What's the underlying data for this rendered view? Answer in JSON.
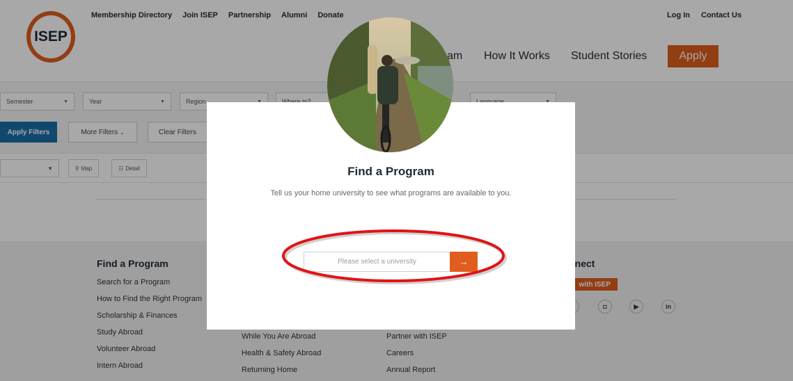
{
  "brand": {
    "logo_text": "ISEP",
    "accent": "#e05d1e",
    "blue": "#1a6ea8"
  },
  "header": {
    "top_links": [
      "Membership Directory",
      "Join ISEP",
      "Partnership",
      "Alumni",
      "Donate"
    ],
    "login": "Log In",
    "contact": "Contact Us",
    "main_nav_partial": "am",
    "main_nav": [
      "How It Works",
      "Student Stories"
    ],
    "apply": "Apply"
  },
  "filters": {
    "semester": "Semester",
    "year": "Year",
    "region": "Region",
    "where": "Where to?",
    "language": "Language",
    "apply_filters": "Apply Filters",
    "more_filters": "More Filters",
    "more_filters_chevron": "chevron-down-icon",
    "clear_filters": "Clear Filters"
  },
  "view": {
    "map": "Map",
    "detail": "Detail"
  },
  "footer": {
    "col1_title": "Find a Program",
    "col1": [
      "Search for a Program",
      "How to Find the Right Program",
      "Scholarship & Finances",
      "Study Abroad",
      "Volunteer Abroad",
      "Intern Abroad"
    ],
    "col2": [
      "While You Are Abroad",
      "Health & Safety Abroad",
      "Returning Home"
    ],
    "col3": [
      "Partner with ISEP",
      "Careers",
      "Annual Report"
    ],
    "col4_title": "nnect",
    "col4_tag": "with ISEP",
    "social_icons": [
      "instagram-icon",
      "youtube-icon",
      "linkedin-icon"
    ]
  },
  "modal": {
    "title": "Find a Program",
    "subtitle": "Tell us your home university to see what programs are available to you.",
    "input_placeholder": "Please select a university",
    "submit_icon": "arrow-right-icon",
    "submit_glyph": "→"
  }
}
